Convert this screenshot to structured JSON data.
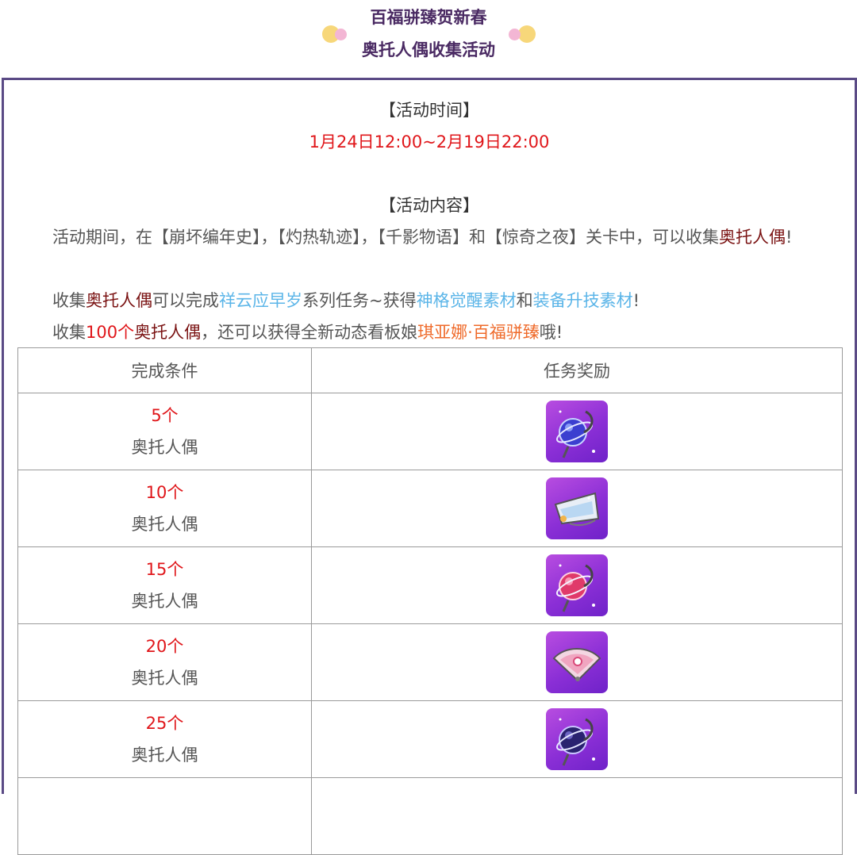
{
  "header": {
    "title_line1": "百福骈臻贺新春",
    "title_line2": "奥托人偶收集活动"
  },
  "activity_time": {
    "heading": "【活动时间】",
    "value": "1月24日12:00~2月19日22:00"
  },
  "activity_content": {
    "heading": "【活动内容】",
    "p1_prefix": "活动期间，在【崩坏编年史】，【灼热轨迹】，【千影物语】和【惊奇之夜】关卡中，可以收集",
    "p1_highlight": "奥托人偶",
    "p1_suffix": "!",
    "p2_a": "收集",
    "p2_b": "奥托人偶",
    "p2_c": "可以完成",
    "p2_d": "祥云应早岁",
    "p2_e": "系列任务~获得",
    "p2_f": "神格觉醒素材",
    "p2_g": "和",
    "p2_h": "装备升技素材",
    "p2_i": "!",
    "p3_a": "收集",
    "p3_b": "100个",
    "p3_c": "奥托人偶",
    "p3_d": "，还可以获得全新动态看板娘",
    "p3_e": "琪亚娜·百福骈臻",
    "p3_f": "哦!"
  },
  "colors": {
    "title": "#4a2a63",
    "frame": "#5a4a85",
    "red": "#e0161a",
    "dark_red": "#7a1212",
    "blue": "#5bb5e8",
    "orange": "#ef6a2a",
    "icon_purple": "#8b2fd6"
  },
  "table": {
    "headers": [
      "完成条件",
      "任务奖励"
    ],
    "rows": [
      {
        "count": "5个",
        "unit": "奥托人偶",
        "reward_icon": "blue-orb-staff-icon"
      },
      {
        "count": "10个",
        "unit": "奥托人偶",
        "reward_icon": "silver-fan-icon"
      },
      {
        "count": "15个",
        "unit": "奥托人偶",
        "reward_icon": "pink-orb-staff-icon"
      },
      {
        "count": "20个",
        "unit": "奥托人偶",
        "reward_icon": "pink-gem-fan-icon"
      },
      {
        "count": "25个",
        "unit": "奥托人偶",
        "reward_icon": "dark-orb-staff-icon"
      }
    ]
  }
}
